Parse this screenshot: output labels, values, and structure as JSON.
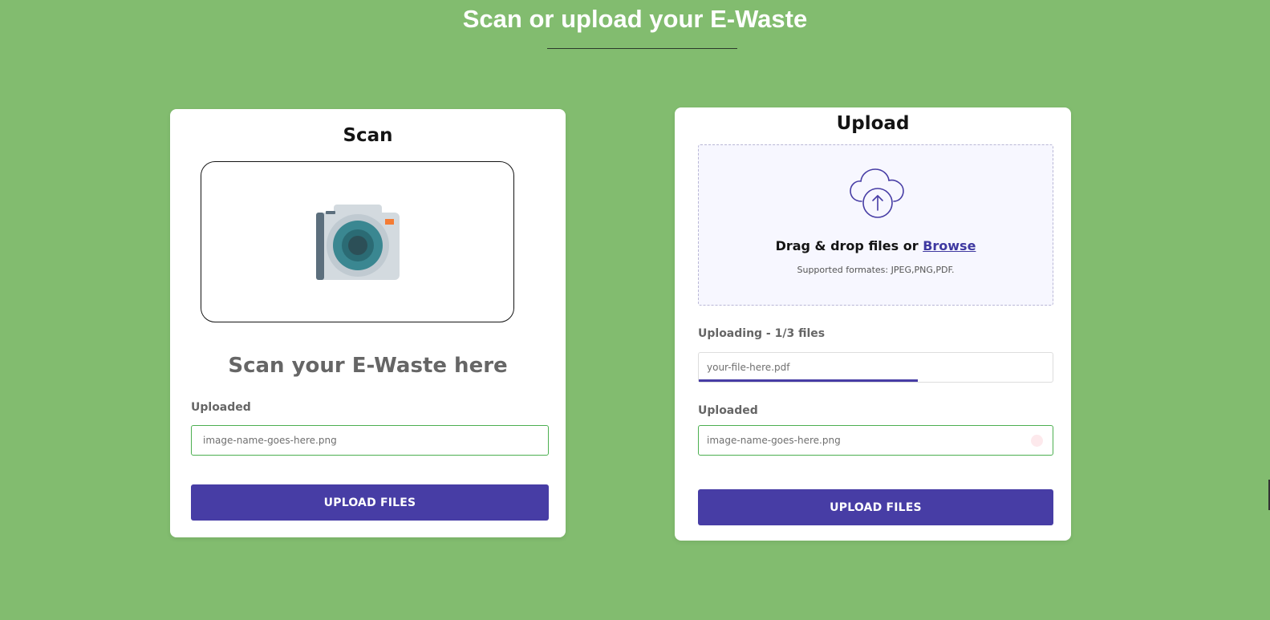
{
  "page": {
    "title": "Scan or upload your E-Waste"
  },
  "scan_card": {
    "heading": "Scan",
    "camera_icon": "camera-icon",
    "caption": "Scan your E-Waste here",
    "uploaded_label": "Uploaded",
    "uploaded_file": "image-name-goes-here.png",
    "button_label": "UPLOAD FILES"
  },
  "upload_card": {
    "heading": "Upload",
    "cloud_icon": "cloud-upload-icon",
    "drop_text": "Drag & drop files or ",
    "browse_label": "Browse",
    "supported": "Supported formates: JPEG,PNG,PDF.",
    "uploading_label": "Uploading - 1/3 files",
    "uploading_file": "your-file-here.pdf",
    "progress_percent": 62,
    "uploaded_label": "Uploaded",
    "uploaded_file": "image-name-goes-here.png",
    "button_label": "UPLOAD FILES"
  },
  "colors": {
    "background": "#82bc6f",
    "accent": "#473da5",
    "success_border": "#4caf50"
  }
}
